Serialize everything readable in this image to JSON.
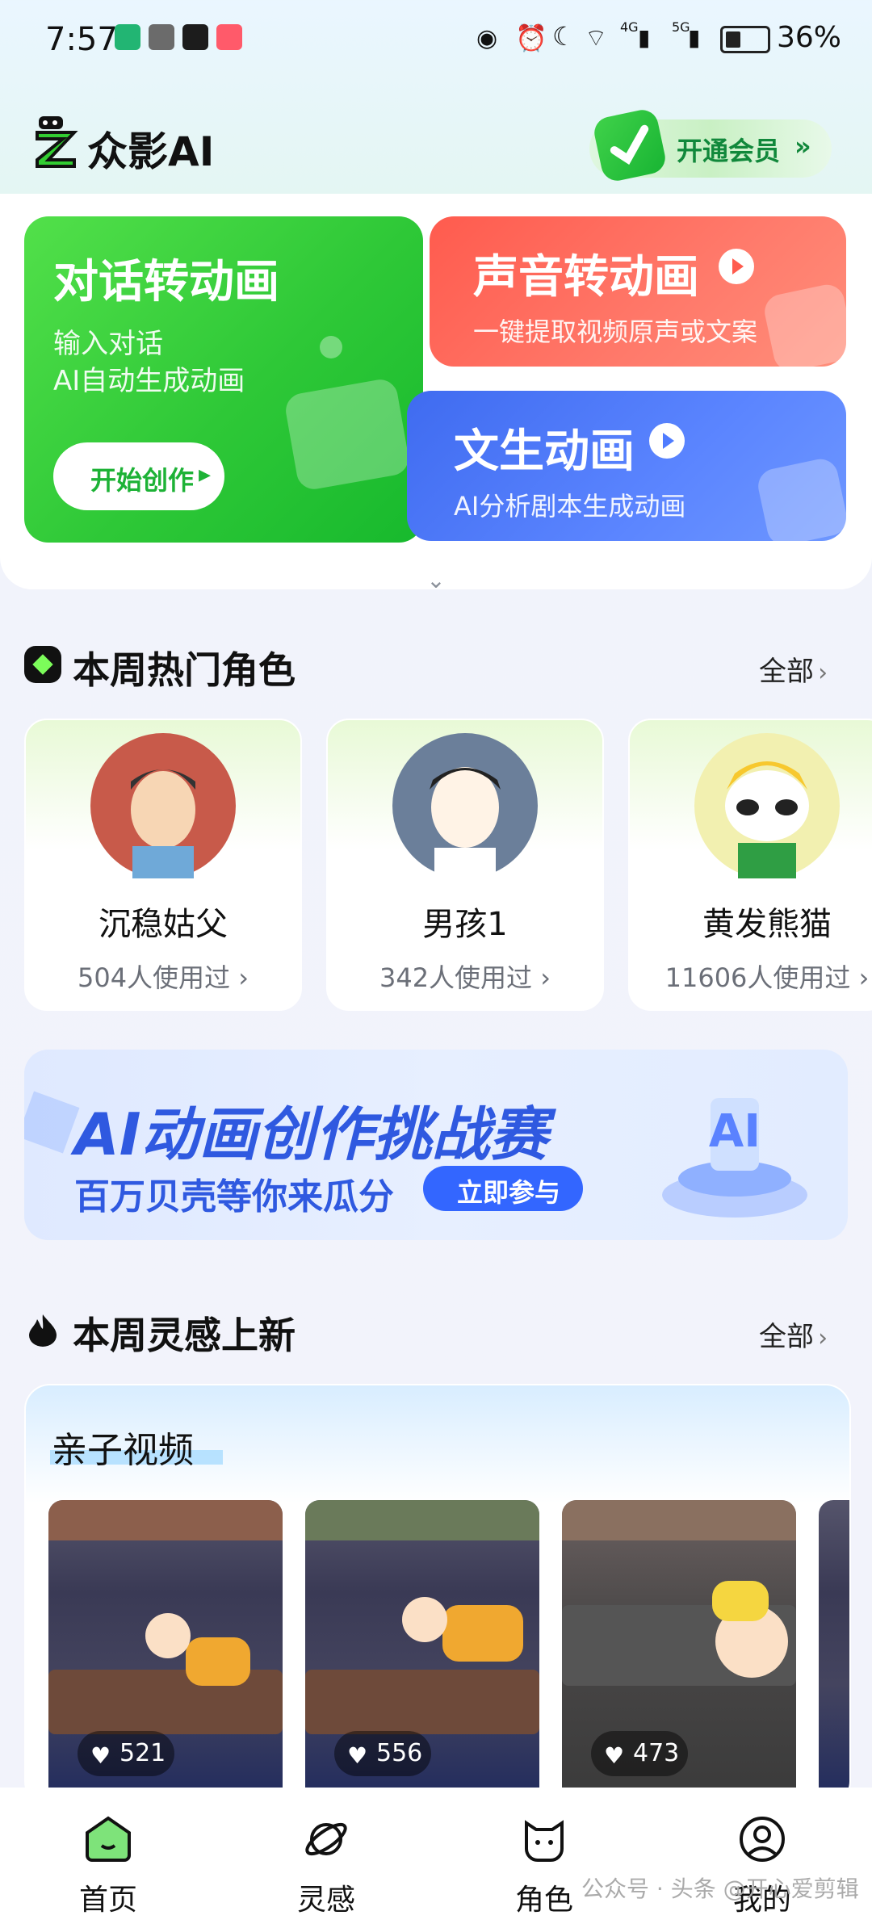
{
  "status_bar": {
    "time": "7:57",
    "battery": "36%",
    "net1": "4G",
    "net2": "5G"
  },
  "header": {
    "brand": "众影AI",
    "vip_label": "开通会员"
  },
  "features": {
    "dialog": {
      "title": "对话转动画",
      "line1": "输入对话",
      "line2": "AI自动生成动画",
      "button": "开始创作"
    },
    "voice": {
      "title": "声音转动画",
      "sub": "一键提取视频原声或文案"
    },
    "text": {
      "title": "文生动画",
      "sub": "AI分析剧本生成动画"
    }
  },
  "hot_roles": {
    "title": "本周热门角色",
    "all": "全部",
    "items": [
      {
        "name": "沉稳姑父",
        "uses": "504人使用过"
      },
      {
        "name": "男孩1",
        "uses": "342人使用过"
      },
      {
        "name": "黄发熊猫",
        "uses": "11606人使用过"
      }
    ]
  },
  "banner": {
    "title": "AI动画创作挑战赛",
    "sub": "百万贝壳等你来瓜分",
    "button": "立即参与"
  },
  "inspiration": {
    "title": "本周灵感上新",
    "all": "全部",
    "category": "亲子视频",
    "videos": [
      {
        "likes": "521"
      },
      {
        "likes": "556"
      },
      {
        "likes": "473"
      }
    ]
  },
  "nav": [
    {
      "label": "首页"
    },
    {
      "label": "灵感"
    },
    {
      "label": "角色"
    },
    {
      "label": "我的"
    }
  ],
  "watermark": "公众号 · 头条 @开心爱剪辑"
}
